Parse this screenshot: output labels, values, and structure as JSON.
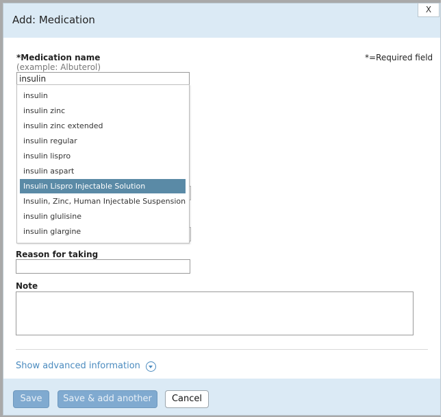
{
  "dialog": {
    "title": "Add: Medication",
    "close_label": "X"
  },
  "form": {
    "medication_label": "*Medication name",
    "medication_hint": "(example: Albuterol)",
    "required_note": "*=Required field",
    "medication_value": "insulin",
    "reason_label": "Reason for taking",
    "reason_value": "",
    "note_label": "Note",
    "note_value": ""
  },
  "autocomplete": {
    "items": [
      "insulin",
      "insulin zinc",
      "insulin zinc extended",
      "insulin regular",
      "insulin lispro",
      "insulin aspart",
      "Insulin Lispro Injectable Solution",
      "Insulin, Zinc, Human Injectable Suspension",
      "insulin glulisine",
      "insulin glargine"
    ],
    "selected_index": 6,
    "selected_color": "#5a8aa6"
  },
  "advanced": {
    "link_label": "Show advanced information",
    "icon": "chevron-down-circle-icon"
  },
  "footer": {
    "save_label": "Save",
    "save_add_label": "Save & add another",
    "cancel_label": "Cancel"
  },
  "colors": {
    "header_bg": "#dbeaf5",
    "link": "#4b8bbf",
    "button_disabled": "#80aad0"
  }
}
